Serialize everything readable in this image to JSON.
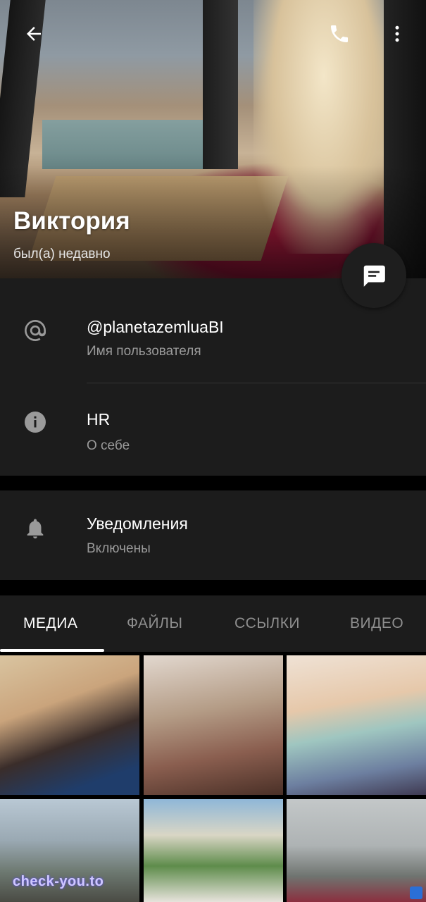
{
  "header": {
    "name": "Виктория",
    "status": "был(а) недавно"
  },
  "info": {
    "username": "@planetazemluaBI",
    "username_label": "Имя пользователя",
    "bio": "HR",
    "bio_label": "О себе"
  },
  "notifications": {
    "title": "Уведомления",
    "value": "Включены"
  },
  "tabs": [
    {
      "label": "МЕДИА",
      "active": true
    },
    {
      "label": "ФАЙЛЫ",
      "active": false
    },
    {
      "label": "ССЫЛКИ",
      "active": false
    },
    {
      "label": "ВИДЕО",
      "active": false
    }
  ],
  "watermark": "check-you.to",
  "colors": {
    "background": "#000000",
    "panel": "#1c1c1c",
    "text_secondary": "#9a9a9a",
    "tab_inactive": "#8e8e8e"
  },
  "icons": [
    "back-arrow-icon",
    "phone-icon",
    "more-vert-icon",
    "message-icon",
    "at-sign-icon",
    "info-icon",
    "bell-icon"
  ]
}
